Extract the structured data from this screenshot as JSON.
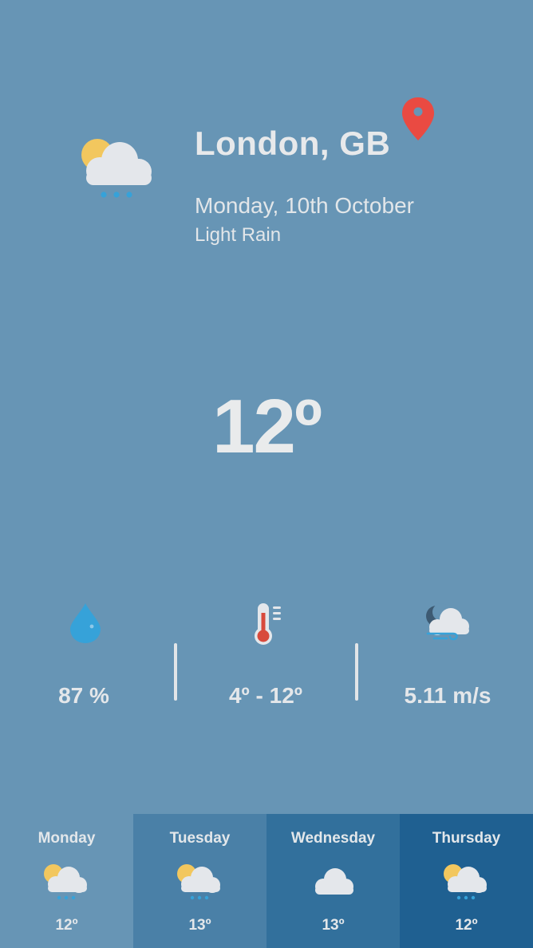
{
  "location": {
    "city": "London, GB",
    "pin_icon": "location-pin-icon"
  },
  "current": {
    "date": "Monday, 10th October",
    "condition": "Light Rain",
    "temperature": "12º",
    "icon": "sun-cloud-rain-icon"
  },
  "stats": {
    "humidity": {
      "icon": "water-drop-icon",
      "value": "87 %"
    },
    "temperature_range": {
      "icon": "thermometer-icon",
      "value": "4º - 12º"
    },
    "wind": {
      "icon": "moon-cloud-wind-icon",
      "value": "5.11 m/s"
    }
  },
  "forecast": [
    {
      "day": "Monday",
      "temp": "12º",
      "icon": "sun-cloud-rain-icon",
      "bg": "#6795b5"
    },
    {
      "day": "Tuesday",
      "temp": "13º",
      "icon": "sun-cloud-rain-icon",
      "bg": "#4a80a7"
    },
    {
      "day": "Wednesday",
      "temp": "13º",
      "icon": "cloud-icon",
      "bg": "#32709c"
    },
    {
      "day": "Thursday",
      "temp": "12º",
      "icon": "sun-cloud-rain-icon",
      "bg": "#1f6091"
    }
  ],
  "colors": {
    "background": "#6795b5",
    "pin": "#ea4a42",
    "sun": "#f2c75e",
    "cloud": "#e4e7eb",
    "rain": "#36a2d9",
    "thermometer": "#d84a3c"
  }
}
